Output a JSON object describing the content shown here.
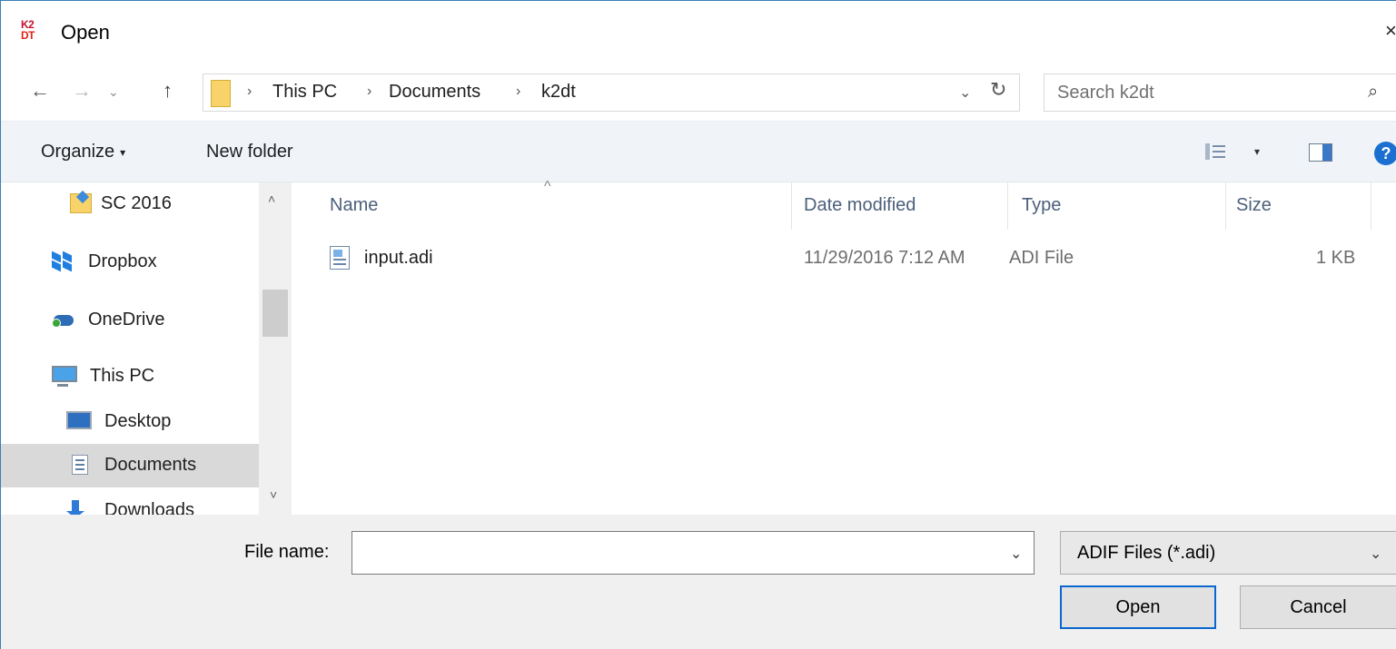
{
  "window": {
    "title": "Open",
    "logo_top": "K2",
    "logo_bottom": "DT",
    "close_glyph": "×"
  },
  "nav": {
    "back_glyph": "←",
    "forward_glyph": "→",
    "recent_glyph": "⌄",
    "up_glyph": "↑"
  },
  "breadcrumb": {
    "items": [
      "This PC",
      "Documents",
      "k2dt"
    ],
    "separator": "›",
    "dropdown_glyph": "⌄",
    "refresh_glyph": "↻"
  },
  "search": {
    "placeholder": "Search k2dt",
    "icon": "⌕"
  },
  "commandbar": {
    "organize_label": "Organize",
    "organize_caret": "▾",
    "new_folder_label": "New folder",
    "view_caret": "▾",
    "help_glyph": "?"
  },
  "navpane": {
    "items": [
      {
        "label": "SC 2016",
        "icon": "folder-icon"
      },
      {
        "label": "Dropbox",
        "icon": "dropbox-icon"
      },
      {
        "label": "OneDrive",
        "icon": "onedrive-icon"
      },
      {
        "label": "This PC",
        "icon": "computer-icon"
      },
      {
        "label": "Desktop",
        "icon": "desktop-icon"
      },
      {
        "label": "Documents",
        "icon": "documents-icon",
        "selected": true
      },
      {
        "label": "Downloads",
        "icon": "downloads-icon"
      }
    ],
    "scroll_up": "˄",
    "scroll_down": "˅"
  },
  "filelist": {
    "sort_glyph": "^",
    "columns": [
      "Name",
      "Date modified",
      "Type",
      "Size"
    ],
    "rows": [
      {
        "name": "input.adi",
        "date": "11/29/2016 7:12 AM",
        "type": "ADI File",
        "size": "1 KB"
      }
    ]
  },
  "footer": {
    "file_name_label": "File name:",
    "file_name_value": "",
    "file_name_caret": "⌄",
    "filter_value": "ADIF Files (*.adi)",
    "filter_caret": "⌄",
    "open_label": "Open",
    "cancel_label": "Cancel"
  },
  "colors": {
    "accent": "#0a67d0",
    "commandbar_bg": "#f0f4f9",
    "selection_bg": "#d9d9d9"
  }
}
